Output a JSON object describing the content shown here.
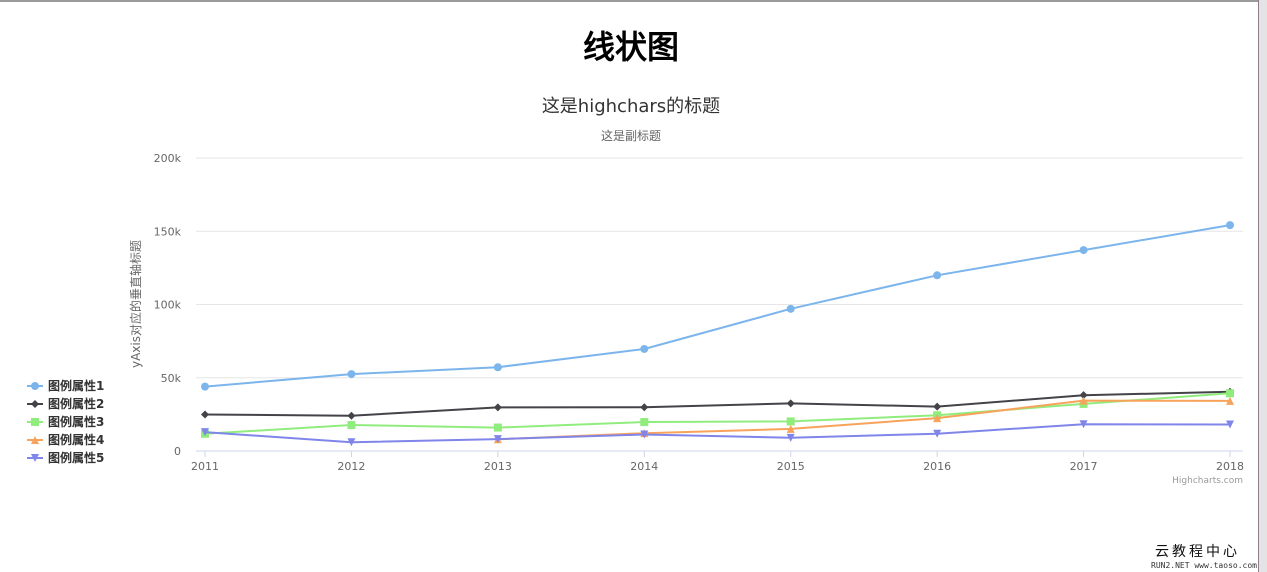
{
  "page": {
    "heading": "线状图",
    "watermark": "云教程中心",
    "watermark_url": "RUN2.NET www.taoso.com"
  },
  "chart_data": {
    "type": "line",
    "title": "这是highchars的标题",
    "subtitle": "这是副标题",
    "xlabel": "",
    "ylabel": "yAxis对应的垂直轴标题",
    "credits": "Highcharts.com",
    "x": [
      2011,
      2012,
      2013,
      2014,
      2015,
      2016,
      2017,
      2018
    ],
    "ylim": [
      0,
      200000
    ],
    "yticks": [
      0,
      50000,
      100000,
      150000,
      200000
    ],
    "ytick_labels": [
      "0",
      "50k",
      "100k",
      "150k",
      "200k"
    ],
    "grid": true,
    "legend_position": "left-middle",
    "series": [
      {
        "name": "图例属性1",
        "color": "#7cb5ec",
        "marker": "circle",
        "values": [
          43934,
          52503,
          57177,
          69658,
          97031,
          119931,
          137133,
          154175
        ]
      },
      {
        "name": "图例属性2",
        "color": "#434348",
        "marker": "diamond",
        "values": [
          24916,
          24064,
          29742,
          29851,
          32490,
          30282,
          38121,
          40434
        ]
      },
      {
        "name": "图例属性3",
        "color": "#90ed7d",
        "marker": "square",
        "values": [
          11744,
          17722,
          16005,
          19771,
          20185,
          24377,
          32147,
          39387
        ]
      },
      {
        "name": "图例属性4",
        "color": "#f7a35c",
        "marker": "triangle",
        "values": [
          null,
          null,
          7988,
          12169,
          15112,
          22452,
          34400,
          34227
        ]
      },
      {
        "name": "图例属性5",
        "color": "#8085e9",
        "marker": "triangle-down",
        "values": [
          12908,
          5948,
          8105,
          11248,
          8989,
          11816,
          18274,
          18111
        ]
      }
    ]
  }
}
